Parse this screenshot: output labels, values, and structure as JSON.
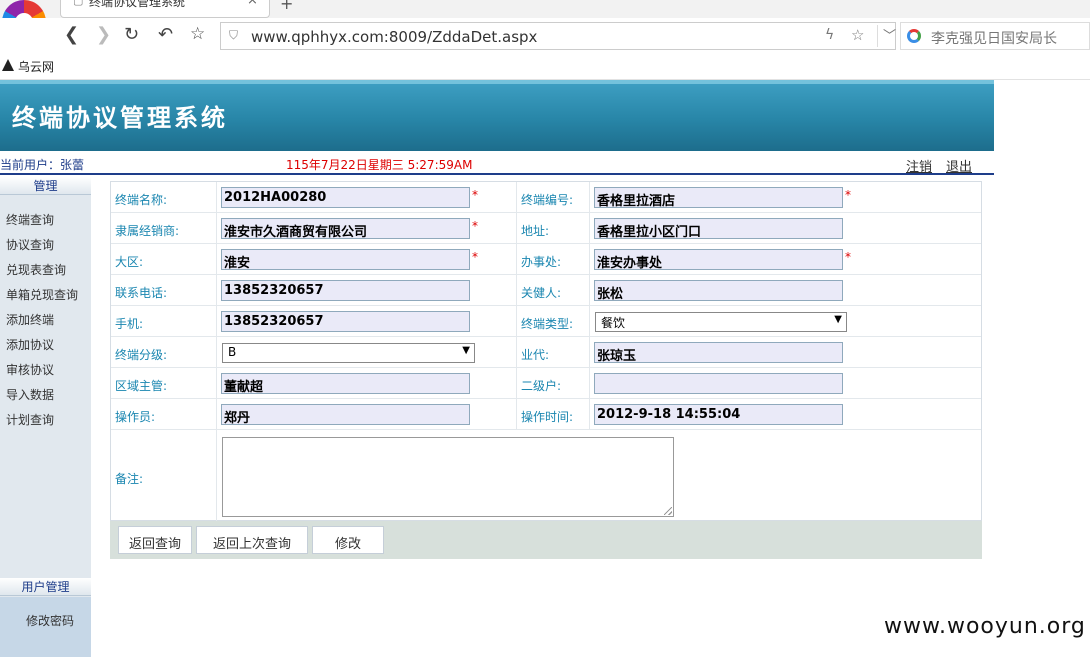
{
  "browser": {
    "tab_title": "终端协议管理系统",
    "url": "www.qphhyx.com:8009/ZddaDet.aspx",
    "search_placeholder": "李克强见日国安局长",
    "bookmark": "乌云网"
  },
  "header": {
    "system_title": "终端协议管理系统",
    "current_user": "当前用户：张蕾",
    "datetime": "115年7月22日星期三 5:27:59AM",
    "logout": "注销",
    "quit": "退出"
  },
  "sidebar": {
    "section1_title": "管理",
    "items": [
      "终端查询",
      "协议查询",
      "兑现表查询",
      "单箱兑现查询",
      "添加终端",
      "添加协议",
      "审核协议",
      "导入数据",
      "计划查询"
    ],
    "section2_title": "用户管理",
    "user_items": [
      "修改密码"
    ]
  },
  "form": {
    "rows": [
      {
        "l1": "终端名称:",
        "v1": "2012HA00280",
        "l2": "终端编号:",
        "v2": "香格里拉酒店"
      },
      {
        "l1": "隶属经销商:",
        "v1": "淮安市久酒商贸有限公司",
        "l2": "地址:",
        "v2": "香格里拉小区门口"
      },
      {
        "l1": "大区:",
        "v1": "淮安",
        "l2": "办事处:",
        "v2": "淮安办事处"
      },
      {
        "l1": "联系电话:",
        "v1": "13852320657",
        "l2": "关健人:",
        "v2": "张松"
      },
      {
        "l1": "手机:",
        "v1": "13852320657",
        "l2": "终端类型:",
        "v2": "餐饮"
      },
      {
        "l1": "终端分级:",
        "v1": "B",
        "l2": "业代:",
        "v2": "张琼玉"
      },
      {
        "l1": "区域主管:",
        "v1": "董献超",
        "l2": "二级户:",
        "v2": ""
      },
      {
        "l1": "操作员:",
        "v1": "郑丹",
        "l2": "操作时间:",
        "v2": "2012-9-18 14:55:04"
      }
    ],
    "remark_label": "备注:",
    "remark_value": "",
    "required_mark": "*"
  },
  "buttons": {
    "back_query": "返回查询",
    "back_last": "返回上次查询",
    "modify": "修改"
  },
  "watermark": "www.wooyun.org"
}
